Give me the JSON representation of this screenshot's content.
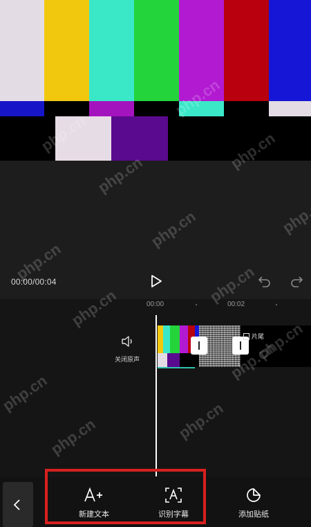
{
  "player": {
    "timecode": "00:00/00:04",
    "play_icon": "play-icon",
    "undo_icon": "undo-icon",
    "redo_icon": "redo-icon"
  },
  "timeline": {
    "ruler": [
      "00:00",
      "00:02"
    ],
    "mute_label": "关闭原声",
    "mute_icon": "speaker-icon",
    "clip_tag": "片尾"
  },
  "toolbar": {
    "back_icon": "chevron-left-icon",
    "items": [
      {
        "label": "新建文本",
        "icon": "add-text-icon"
      },
      {
        "label": "识别字幕",
        "icon": "recognize-subtitle-icon"
      },
      {
        "label": "添加贴纸",
        "icon": "sticker-icon"
      }
    ]
  },
  "watermark": "php.cn",
  "colors": {
    "highlight": "#d8201f",
    "track_accent": "#2fc0b0"
  }
}
